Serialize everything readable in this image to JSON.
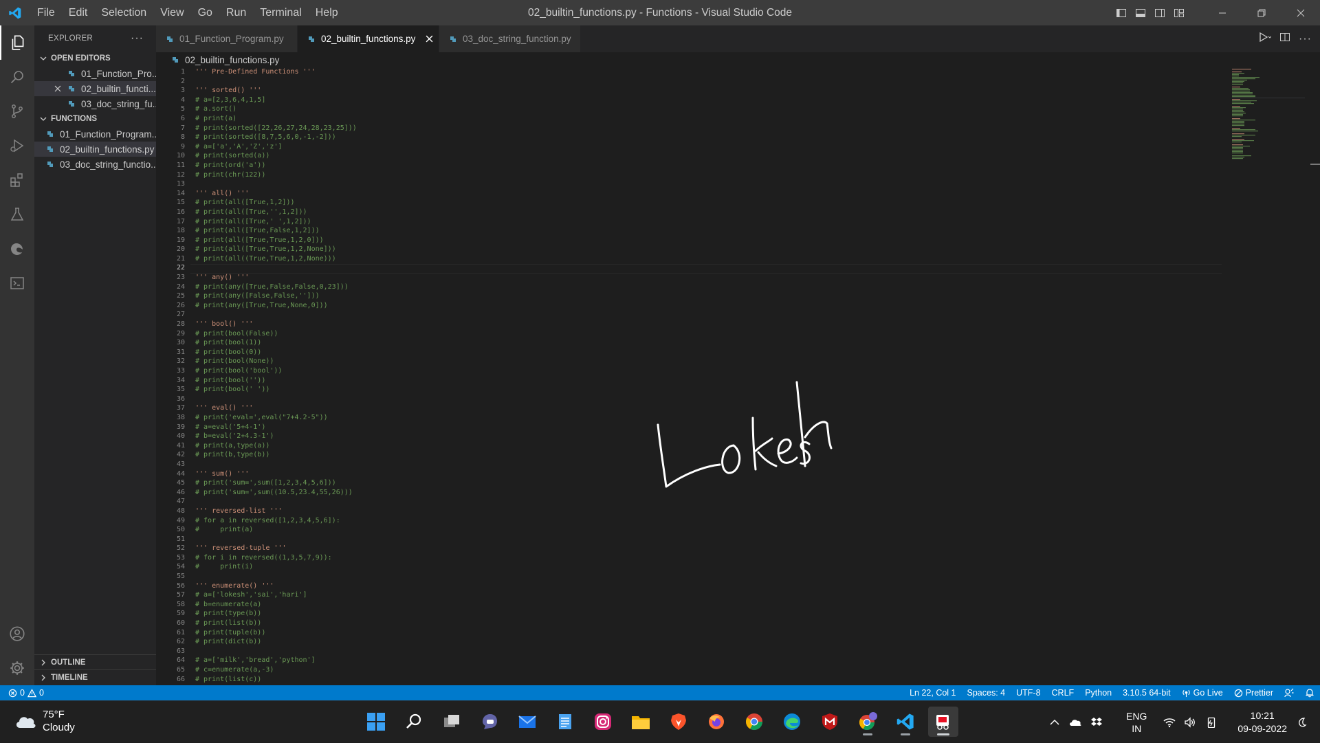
{
  "titlebar": {
    "menu": [
      "File",
      "Edit",
      "Selection",
      "View",
      "Go",
      "Run",
      "Terminal",
      "Help"
    ],
    "window_title": "02_builtin_functions.py - Functions - Visual Studio Code"
  },
  "sidebar": {
    "header": "EXPLORER",
    "open_editors_label": "OPEN EDITORS",
    "open_editors": [
      "01_Function_Pro...",
      "02_builtin_functi...",
      "03_doc_string_fu..."
    ],
    "folder_label": "FUNCTIONS",
    "files": [
      "01_Function_Program...",
      "02_builtin_functions.py",
      "03_doc_string_functio..."
    ],
    "outline_label": "OUTLINE",
    "timeline_label": "TIMELINE"
  },
  "tabs": [
    "01_Function_Program.py",
    "02_builtin_functions.py",
    "03_doc_string_function.py"
  ],
  "breadcrumb": "02_builtin_functions.py",
  "editor": {
    "current_line": 22,
    "lines": [
      {
        "n": "1",
        "t": "''' Pre-Defined Functions '''",
        "k": "docstring"
      },
      {
        "n": "2",
        "t": "",
        "k": "blank"
      },
      {
        "n": "3",
        "t": "''' sorted() '''",
        "k": "docstring"
      },
      {
        "n": "4",
        "t": "# a=[2,3,6,4,1,5]",
        "k": "comment"
      },
      {
        "n": "5",
        "t": "# a.sort()",
        "k": "comment"
      },
      {
        "n": "6",
        "t": "# print(a)",
        "k": "comment"
      },
      {
        "n": "7",
        "t": "# print(sorted([22,26,27,24,28,23,25]))",
        "k": "comment"
      },
      {
        "n": "8",
        "t": "# print(sorted([8,7,5,6,0,-1,-2]))",
        "k": "comment"
      },
      {
        "n": "9",
        "t": "# a=['a','A','Z','z']",
        "k": "comment"
      },
      {
        "n": "10",
        "t": "# print(sorted(a))",
        "k": "comment"
      },
      {
        "n": "11",
        "t": "# print(ord('a'))",
        "k": "comment"
      },
      {
        "n": "12",
        "t": "# print(chr(122))",
        "k": "comment"
      },
      {
        "n": "13",
        "t": "",
        "k": "blank"
      },
      {
        "n": "14",
        "t": "''' all() '''",
        "k": "docstring"
      },
      {
        "n": "15",
        "t": "# print(all([True,1,2]))",
        "k": "comment"
      },
      {
        "n": "16",
        "t": "# print(all([True,'',1,2]))",
        "k": "comment"
      },
      {
        "n": "17",
        "t": "# print(all([True,' ',1,2]))",
        "k": "comment"
      },
      {
        "n": "18",
        "t": "# print(all([True,False,1,2]))",
        "k": "comment"
      },
      {
        "n": "19",
        "t": "# print(all([True,True,1,2,0]))",
        "k": "comment"
      },
      {
        "n": "20",
        "t": "# print(all([True,True,1,2,None]))",
        "k": "comment"
      },
      {
        "n": "21",
        "t": "# print(all((True,True,1,2,None)))",
        "k": "comment"
      },
      {
        "n": "22",
        "t": "",
        "k": "blank"
      },
      {
        "n": "23",
        "t": "''' any() '''",
        "k": "docstring"
      },
      {
        "n": "24",
        "t": "# print(any([True,False,False,0,23]))",
        "k": "comment"
      },
      {
        "n": "25",
        "t": "# print(any([False,False,'']))",
        "k": "comment"
      },
      {
        "n": "26",
        "t": "# print(any([True,True,None,0]))",
        "k": "comment"
      },
      {
        "n": "27",
        "t": "",
        "k": "blank"
      },
      {
        "n": "28",
        "t": "''' bool() '''",
        "k": "docstring"
      },
      {
        "n": "29",
        "t": "# print(bool(False))",
        "k": "comment"
      },
      {
        "n": "30",
        "t": "# print(bool(1))",
        "k": "comment"
      },
      {
        "n": "31",
        "t": "# print(bool(0))",
        "k": "comment"
      },
      {
        "n": "32",
        "t": "# print(bool(None))",
        "k": "comment"
      },
      {
        "n": "33",
        "t": "# print(bool('bool'))",
        "k": "comment"
      },
      {
        "n": "34",
        "t": "# print(bool(''))",
        "k": "comment"
      },
      {
        "n": "35",
        "t": "# print(bool(' '))",
        "k": "comment"
      },
      {
        "n": "36",
        "t": "",
        "k": "blank"
      },
      {
        "n": "37",
        "t": "''' eval() '''",
        "k": "docstring"
      },
      {
        "n": "38",
        "t": "# print('eval=',eval(\"7+4.2-5\"))",
        "k": "comment"
      },
      {
        "n": "39",
        "t": "# a=eval('5+4-1')",
        "k": "comment"
      },
      {
        "n": "40",
        "t": "# b=eval('2+4.3-1')",
        "k": "comment"
      },
      {
        "n": "41",
        "t": "# print(a,type(a))",
        "k": "comment"
      },
      {
        "n": "42",
        "t": "# print(b,type(b))",
        "k": "comment"
      },
      {
        "n": "43",
        "t": "",
        "k": "blank"
      },
      {
        "n": "44",
        "t": "''' sum() '''",
        "k": "docstring"
      },
      {
        "n": "45",
        "t": "# print('sum=',sum([1,2,3,4,5,6]))",
        "k": "comment"
      },
      {
        "n": "46",
        "t": "# print('sum=',sum((10.5,23.4,55,26)))",
        "k": "comment"
      },
      {
        "n": "47",
        "t": "",
        "k": "blank"
      },
      {
        "n": "48",
        "t": "''' reversed-list '''",
        "k": "docstring"
      },
      {
        "n": "49",
        "t": "# for a in reversed([1,2,3,4,5,6]):",
        "k": "comment"
      },
      {
        "n": "50",
        "t": "#     print(a)",
        "k": "comment"
      },
      {
        "n": "51",
        "t": "",
        "k": "blank"
      },
      {
        "n": "52",
        "t": "''' reversed-tuple '''",
        "k": "docstring"
      },
      {
        "n": "53",
        "t": "# for i in reversed((1,3,5,7,9)):",
        "k": "comment"
      },
      {
        "n": "54",
        "t": "#     print(i)",
        "k": "comment"
      },
      {
        "n": "55",
        "t": "",
        "k": "blank"
      },
      {
        "n": "56",
        "t": "''' enumerate() '''",
        "k": "docstring"
      },
      {
        "n": "57",
        "t": "# a=['lokesh','sai','hari']",
        "k": "comment"
      },
      {
        "n": "58",
        "t": "# b=enumerate(a)",
        "k": "comment"
      },
      {
        "n": "59",
        "t": "# print(type(b))",
        "k": "comment"
      },
      {
        "n": "60",
        "t": "# print(list(b))",
        "k": "comment"
      },
      {
        "n": "61",
        "t": "# print(tuple(b))",
        "k": "comment"
      },
      {
        "n": "62",
        "t": "# print(dict(b))",
        "k": "comment"
      },
      {
        "n": "63",
        "t": "",
        "k": "blank"
      },
      {
        "n": "64",
        "t": "# a=['milk','bread','python']",
        "k": "comment"
      },
      {
        "n": "65",
        "t": "# c=enumerate(a,-3)",
        "k": "comment"
      },
      {
        "n": "66",
        "t": "# print(list(c))",
        "k": "comment"
      }
    ],
    "signature": "Lokesh"
  },
  "statusbar": {
    "errors": "0",
    "warnings": "0",
    "position": "Ln 22, Col 1",
    "spaces": "Spaces: 4",
    "encoding": "UTF-8",
    "eol": "CRLF",
    "language": "Python",
    "interpreter": "3.10.5 64-bit",
    "go_live": "Go Live",
    "prettier": "Prettier"
  },
  "taskbar": {
    "temperature": "75°F",
    "condition": "Cloudy",
    "lang_top": "ENG",
    "lang_bottom": "IN",
    "time": "10:21",
    "date": "09-09-2022"
  },
  "colors": {
    "accent": "#007acc",
    "comment": "#6a9955",
    "docstring": "#ce9178",
    "python_icon": "#519aba"
  }
}
